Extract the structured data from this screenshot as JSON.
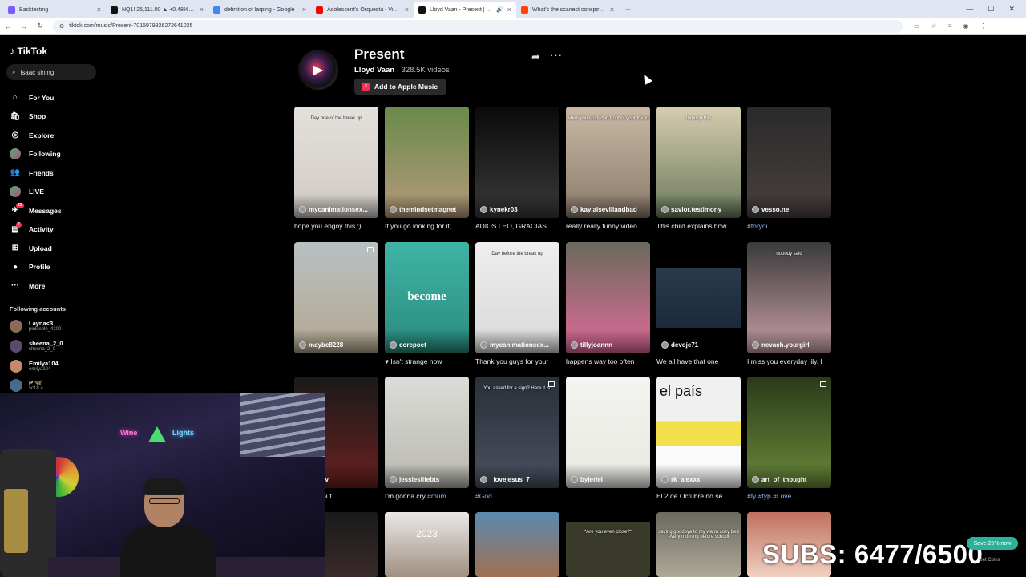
{
  "browser": {
    "tabs": [
      {
        "title": "Backtesting",
        "color": "#7b5cff"
      },
      {
        "title": "NQ1! 25,111.00 ▲ +0.48% Unn",
        "color": "#111111"
      },
      {
        "title": "definition of larping - Google",
        "color": "#4285f4"
      },
      {
        "title": "Adolescent's Orquesta - Virgen",
        "color": "#ff0000"
      },
      {
        "title": "Lloyd Vaan - Present | TikTo",
        "color": "#111111"
      },
      {
        "title": "What's the scariest conspiracy",
        "color": "#ff4500"
      }
    ],
    "url": "tiktok.com/music/Present-7015979926272641025"
  },
  "sidebar": {
    "logo": "TikTok",
    "search_value": "isaac sining",
    "menu": [
      {
        "label": "For You",
        "icon": "home-icon"
      },
      {
        "label": "Shop",
        "icon": "shop-icon"
      },
      {
        "label": "Explore",
        "icon": "compass-icon"
      },
      {
        "label": "Following",
        "icon": "following-avatar-icon"
      },
      {
        "label": "Friends",
        "icon": "friends-icon"
      },
      {
        "label": "LIVE",
        "icon": "live-avatar-icon"
      },
      {
        "label": "Messages",
        "icon": "messages-icon",
        "badge": "23"
      },
      {
        "label": "Activity",
        "icon": "activity-icon",
        "badge": "7"
      },
      {
        "label": "Upload",
        "icon": "upload-icon"
      },
      {
        "label": "Profile",
        "icon": "profile-icon"
      },
      {
        "label": "More",
        "icon": "more-icon"
      }
    ],
    "following_header": "Following accounts",
    "accounts": [
      {
        "name": "Layna<3",
        "handle": "pinkieple_4200"
      },
      {
        "name": "sheena_2_0",
        "handle": "sheena_2_0"
      },
      {
        "name": "Emilya104",
        "handle": "emilya104"
      },
      {
        "name": "P 🦋",
        "handle": "sc18.a"
      }
    ]
  },
  "sound": {
    "title": "Present",
    "artist": "Lloyd Vaan",
    "video_count": " · 328.5K videos",
    "apple_music_label": "Add to Apple Music"
  },
  "videos": [
    {
      "user": "mycanimationsex...",
      "caption": "hope you engoy this :)",
      "overlay": "Day one of the break up"
    },
    {
      "user": "themindsetmagnet",
      "caption": "If you go looking for it,",
      "overlay": ""
    },
    {
      "user": "kynekr03",
      "caption": "ADIOS LEO, GRACIAS",
      "overlay": ""
    },
    {
      "user": "kaylaisevillandbad",
      "caption": "really really funny video",
      "overlay": "when you stuffed in front of your friend"
    },
    {
      "user": "savior.testimony",
      "caption": "This child explains how",
      "overlay": "through this"
    },
    {
      "user": "vesso.ne",
      "caption": "",
      "tag": "#foryou",
      "overlay": ""
    },
    {
      "user": "maybe8228",
      "caption": "",
      "overlay": ""
    },
    {
      "user": "corepoet",
      "caption": "♥ Isn't strange how",
      "overlay": "",
      "big": "become"
    },
    {
      "user": "mycanimationsex...",
      "caption": "Thank you guys for your",
      "overlay": "Day before the break up"
    },
    {
      "user": "tillyjoannn",
      "caption": "happens way too often",
      "overlay": ""
    },
    {
      "user": "devoje71",
      "caption": "We all have that one",
      "overlay": ""
    },
    {
      "user": "nevaeh.yourgirl",
      "caption": "I miss you everyday lily. I",
      "overlay": "nobody said"
    },
    {
      "user": "fort_tv_",
      "caption": "I Hate About",
      "overlay": ""
    },
    {
      "user": "jessieslifebts",
      "caption": "I'm gonna cry ",
      "tag": "#mum",
      "overlay": ""
    },
    {
      "user": "_lovejesus_7",
      "caption": "",
      "tag": "#God",
      "overlay": "You asked for a sign? Here it is."
    },
    {
      "user": "byjeriel",
      "caption": "",
      "overlay": ""
    },
    {
      "user": "rk_alexxx",
      "caption": "El 2 de Octubre no se",
      "overlay": "",
      "big": "el país"
    },
    {
      "user": "art_of_thought",
      "caption": "",
      "tag": "#fy #fyp #Love",
      "overlay": ""
    },
    {
      "user": "",
      "caption": "",
      "overlay": ""
    },
    {
      "user": "",
      "caption": "",
      "overlay": "2023"
    },
    {
      "user": "",
      "caption": "",
      "overlay": ""
    },
    {
      "user": "",
      "caption": "",
      "overlay": "*Are you even close?*"
    },
    {
      "user": "",
      "caption": "",
      "overlay": "saying goodbye to my warm cozy bed every morning before school"
    },
    {
      "user": "",
      "caption": "",
      "overlay": ""
    }
  ],
  "stream": {
    "subs_label": "SUBS: 6477/6500",
    "save_label": "Save 25% now",
    "coins_label": "Get Coins",
    "neon1": "Wine",
    "neon2": "Lights"
  }
}
